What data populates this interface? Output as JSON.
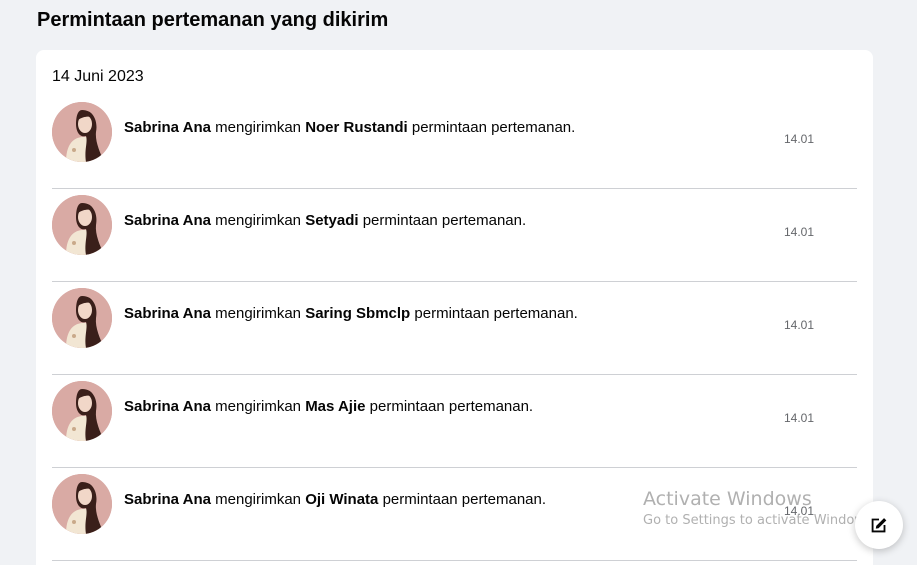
{
  "page": {
    "title": "Permintaan pertemanan yang dikirim"
  },
  "section": {
    "date": "14 Juni 2023",
    "connector": "mengirimkan",
    "suffix": "permintaan pertemanan.",
    "items": [
      {
        "sender": "Sabrina Ana",
        "recipient": "Noer Rustandi",
        "time": "14.01"
      },
      {
        "sender": "Sabrina Ana",
        "recipient": "Setyadi",
        "time": "14.01"
      },
      {
        "sender": "Sabrina Ana",
        "recipient": "Saring Sbmclp",
        "time": "14.01"
      },
      {
        "sender": "Sabrina Ana",
        "recipient": "Mas Ajie",
        "time": "14.01"
      },
      {
        "sender": "Sabrina Ana",
        "recipient": "Oji Winata",
        "time": "14.01"
      }
    ]
  },
  "watermark": {
    "title": "Activate Windows",
    "subtitle": "Go to Settings to activate Windows."
  },
  "icons": {
    "avatar": "profile-picture-illustration",
    "fab": "compose-edit-icon"
  },
  "colors": {
    "background": "#f0f2f5",
    "card": "#ffffff",
    "divider": "#ced0d4",
    "secondary_text": "#65676b"
  }
}
